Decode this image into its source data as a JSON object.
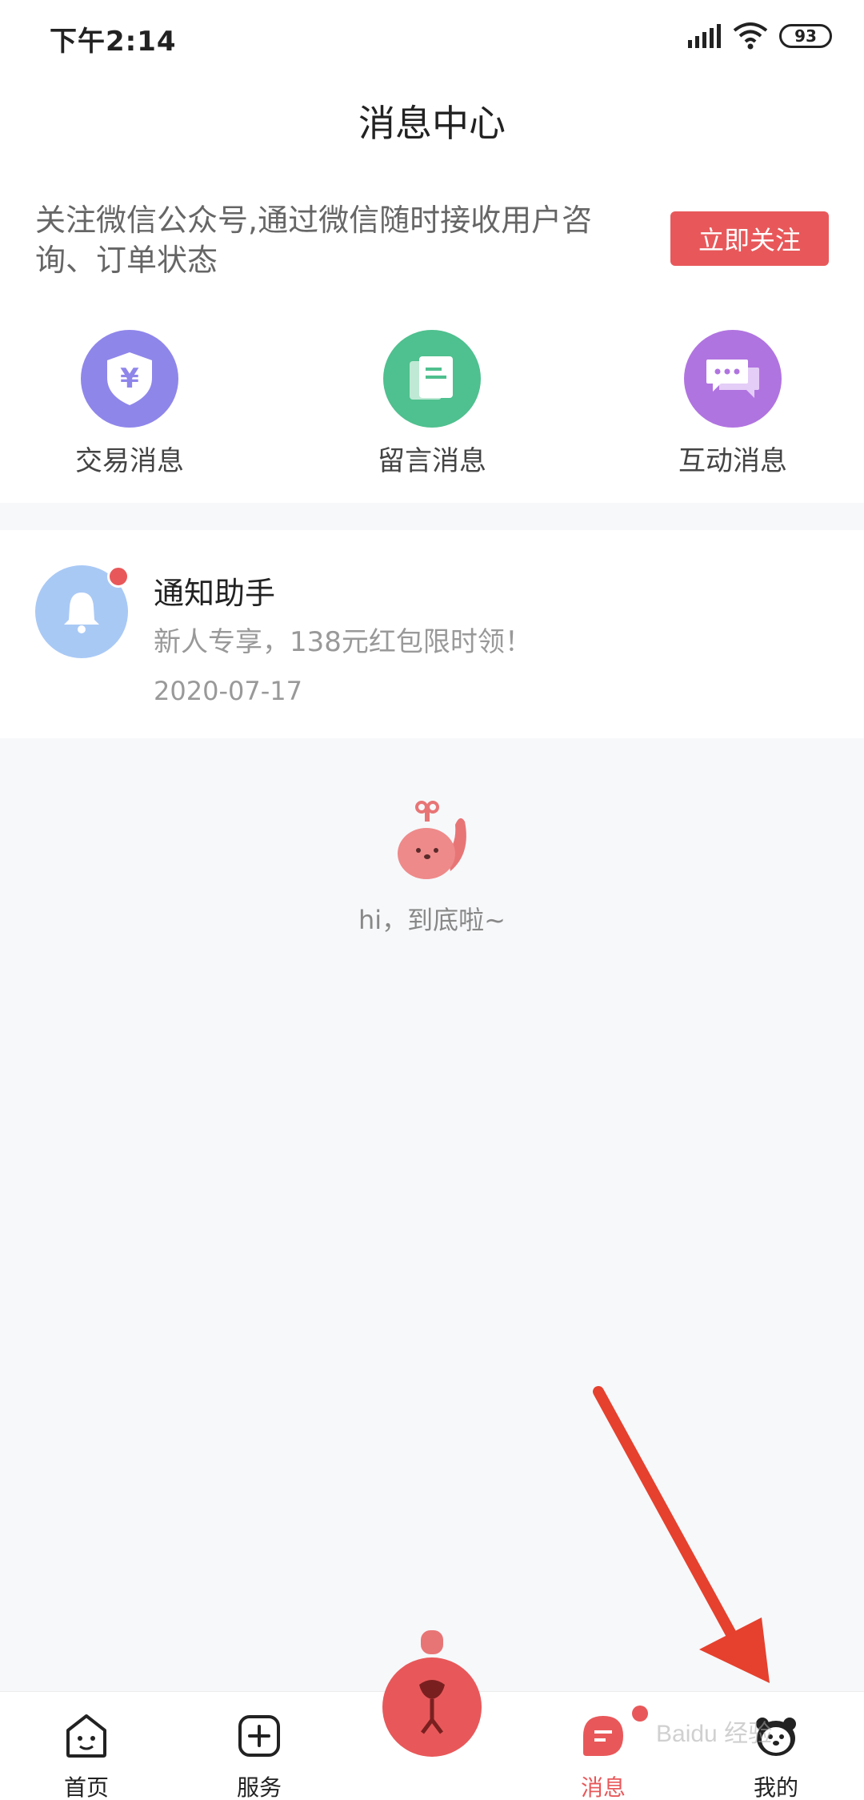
{
  "status_bar": {
    "time": "下午2:14",
    "battery": "93"
  },
  "header": {
    "title": "消息中心"
  },
  "follow_banner": {
    "text": "关注微信公众号,通过微信随时接收用户咨询、订单状态",
    "button": "立即关注"
  },
  "categories": [
    {
      "label": "交易消息",
      "icon": "shield-yen-icon",
      "color": "#8f86ea"
    },
    {
      "label": "留言消息",
      "icon": "document-icon",
      "color": "#4fc08f"
    },
    {
      "label": "互动消息",
      "icon": "chat-bubbles-icon",
      "color": "#b074e0"
    }
  ],
  "notification": {
    "title": "通知助手",
    "message": "新人专享，138元红包限时领！",
    "date": "2020-07-17",
    "icon": "bell-icon"
  },
  "end_text": "hi，到底啦~",
  "tabbar": {
    "items": [
      {
        "label": "首页",
        "icon": "home-face-icon"
      },
      {
        "label": "服务",
        "icon": "plus-square-icon"
      },
      {
        "label": "消息",
        "icon": "message-icon",
        "active": true
      },
      {
        "label": "我的",
        "icon": "bear-face-icon"
      }
    ]
  },
  "watermark": "Baidu 经验",
  "colors": {
    "accent": "#e8585a",
    "background": "#f7f8fa"
  }
}
